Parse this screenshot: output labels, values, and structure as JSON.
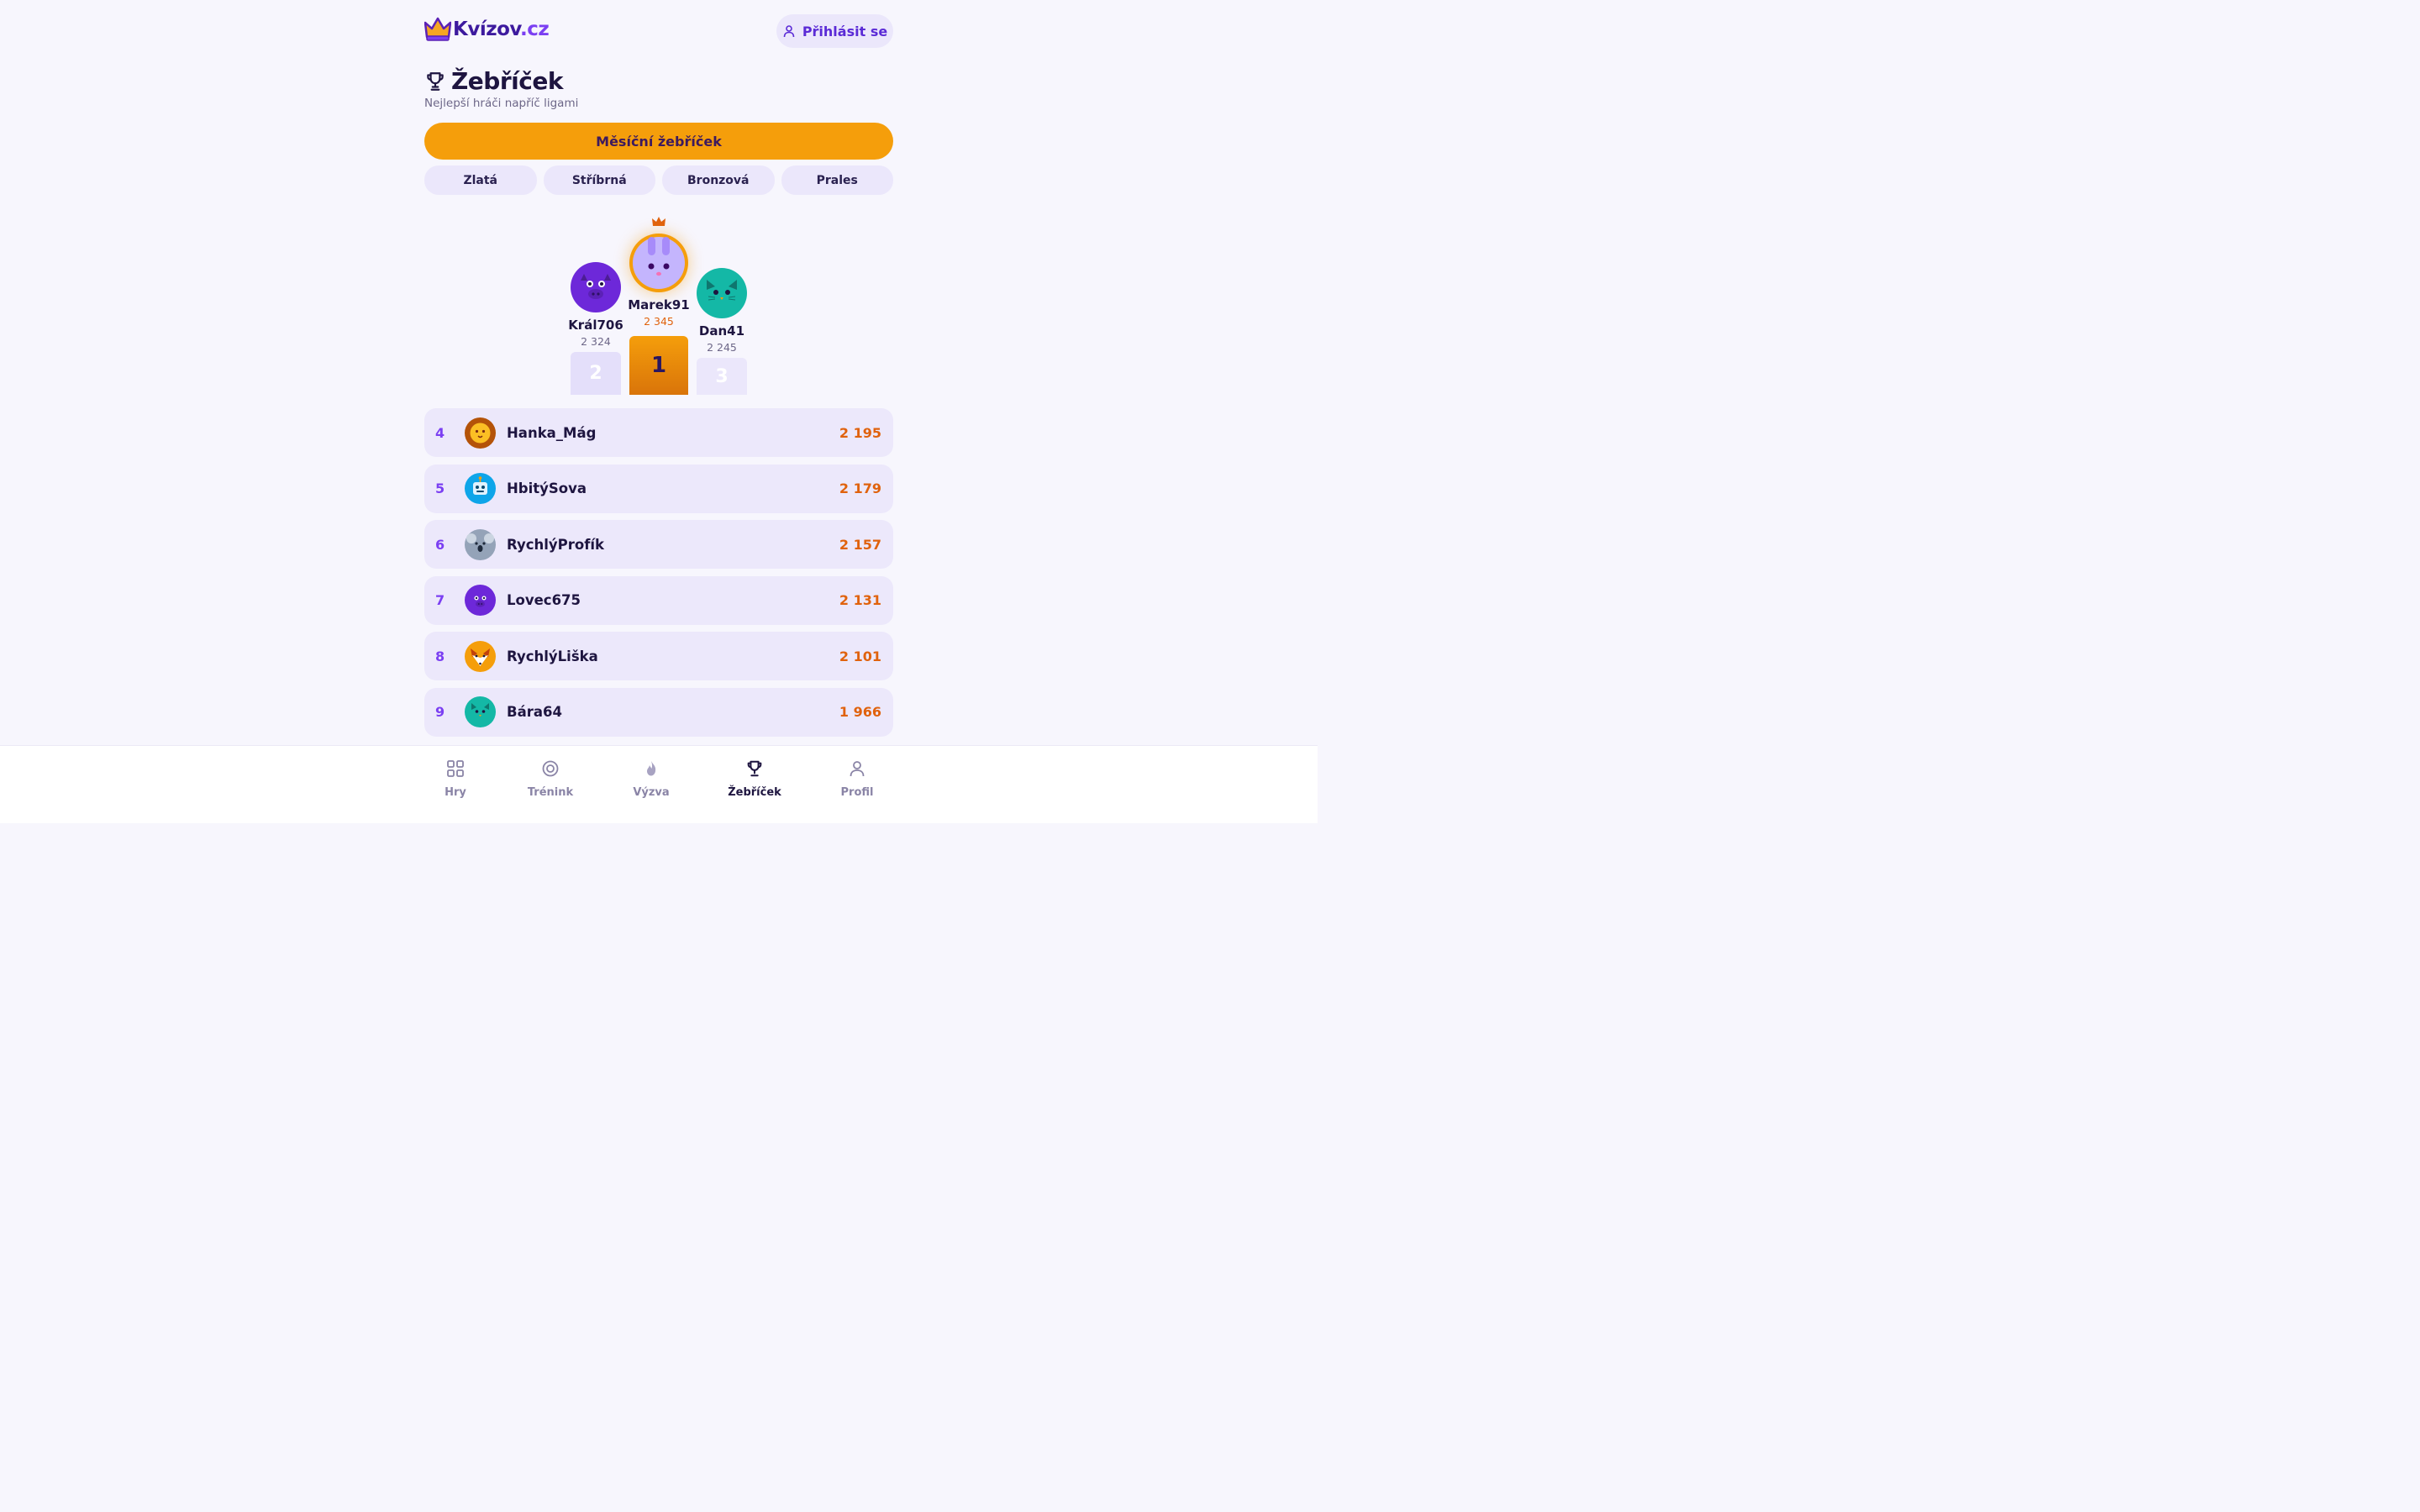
{
  "header": {
    "logo_main": "Kvízov",
    "logo_tld": ".cz",
    "login_label": "Přihlásit se"
  },
  "page": {
    "title": "Žebříček",
    "subtitle": "Nejlepší hráči napříč ligami",
    "monthly_label": "Měsíční žebříček"
  },
  "tabs": [
    "Zlatá",
    "Stříbrná",
    "Bronzová",
    "Prales"
  ],
  "podium": {
    "first": {
      "name": "Marek91",
      "score": "2 345",
      "place": "1",
      "avatar": "bunny-icon"
    },
    "second": {
      "name": "Král706",
      "score": "2 324",
      "place": "2",
      "avatar": "monster-icon"
    },
    "third": {
      "name": "Dan41",
      "score": "2 245",
      "place": "3",
      "avatar": "cat-icon"
    }
  },
  "ranking": [
    {
      "rank": "4",
      "name": "Hanka_Mág",
      "score": "2 195",
      "avatar": "lion-icon"
    },
    {
      "rank": "5",
      "name": "HbitýSova",
      "score": "2 179",
      "avatar": "robot-icon"
    },
    {
      "rank": "6",
      "name": "RychlýProfík",
      "score": "2 157",
      "avatar": "koala-icon"
    },
    {
      "rank": "7",
      "name": "Lovec675",
      "score": "2 131",
      "avatar": "monster-icon"
    },
    {
      "rank": "8",
      "name": "RychlýLiška",
      "score": "2 101",
      "avatar": "fox-icon"
    },
    {
      "rank": "9",
      "name": "Bára64",
      "score": "1 966",
      "avatar": "cat-icon"
    }
  ],
  "nav": [
    {
      "label": "Hry",
      "icon": "grid-icon"
    },
    {
      "label": "Trénink",
      "icon": "target-icon"
    },
    {
      "label": "Výzva",
      "icon": "flame-icon"
    },
    {
      "label": "Žebříček",
      "icon": "trophy-icon"
    },
    {
      "label": "Profil",
      "icon": "user-icon"
    }
  ],
  "colors": {
    "accent": "#7b3ff2",
    "orange": "#f59e0b",
    "score": "#e0620d",
    "background": "#f7f6fd"
  }
}
